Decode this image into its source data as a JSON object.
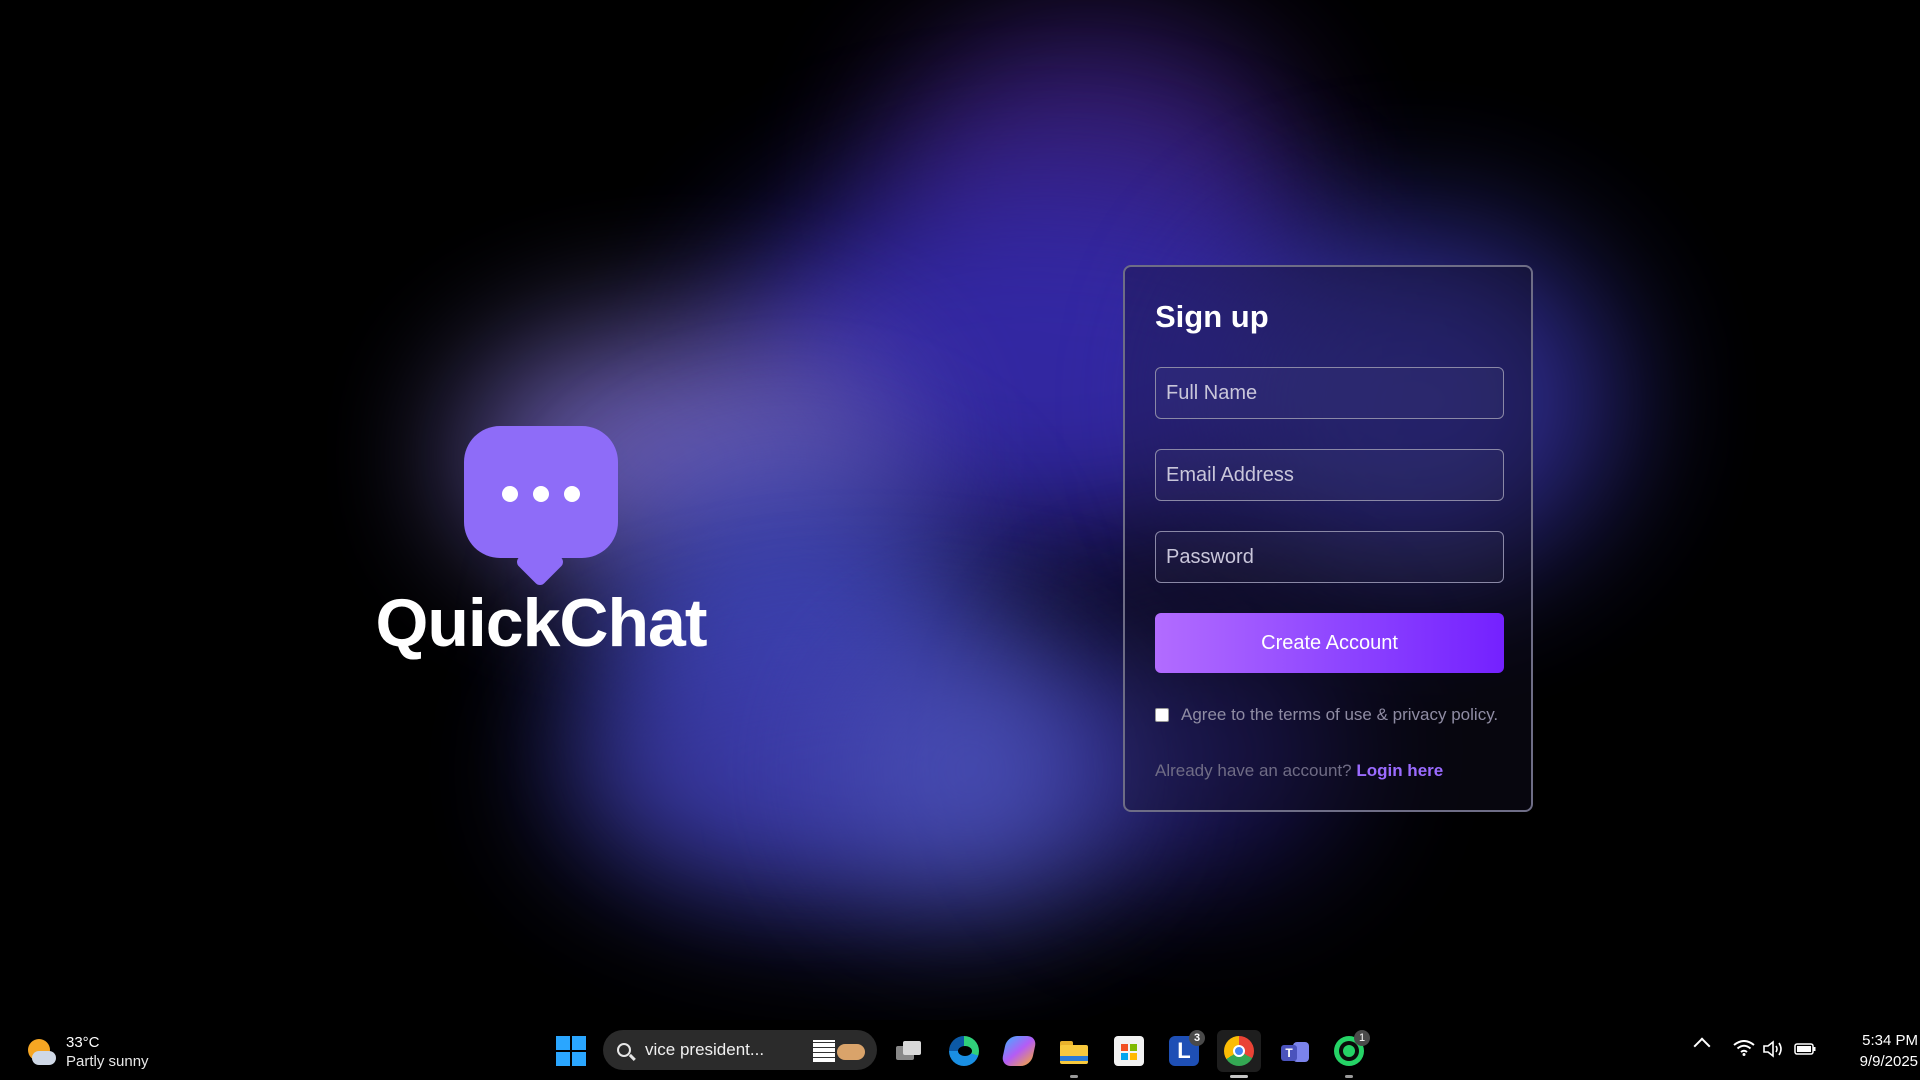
{
  "brand": {
    "name": "QuickChat",
    "logo_icon": "chat-bubble-icon",
    "color": "#8e6cf8"
  },
  "signup": {
    "title": "Sign up",
    "full_name_placeholder": "Full Name",
    "email_placeholder": "Email Address",
    "password_placeholder": "Password",
    "create_button": "Create Account",
    "terms_label": "Agree to the terms of use & privacy policy.",
    "login_prompt": "Already have an account?",
    "login_link": "Login here",
    "accent": "#8d44ff"
  },
  "taskbar": {
    "weather": {
      "temp": "33°C",
      "condition": "Partly sunny",
      "icon": "partly-sunny-icon"
    },
    "search_text": "vice president...",
    "apps": [
      {
        "name": "task-view",
        "icon": "task-view-icon"
      },
      {
        "name": "edge",
        "icon": "edge-icon"
      },
      {
        "name": "copilot",
        "icon": "copilot-icon"
      },
      {
        "name": "file-explorer",
        "icon": "folder-icon"
      },
      {
        "name": "microsoft-store",
        "icon": "store-icon"
      },
      {
        "name": "l-app",
        "icon": "l-app-icon",
        "label": "L",
        "badge": "3"
      },
      {
        "name": "chrome",
        "icon": "chrome-icon"
      },
      {
        "name": "teams",
        "icon": "teams-icon"
      },
      {
        "name": "whatsapp",
        "icon": "whatsapp-icon",
        "badge": "1"
      }
    ],
    "clock": {
      "time": "5:34 PM",
      "date": "9/9/2025"
    }
  }
}
